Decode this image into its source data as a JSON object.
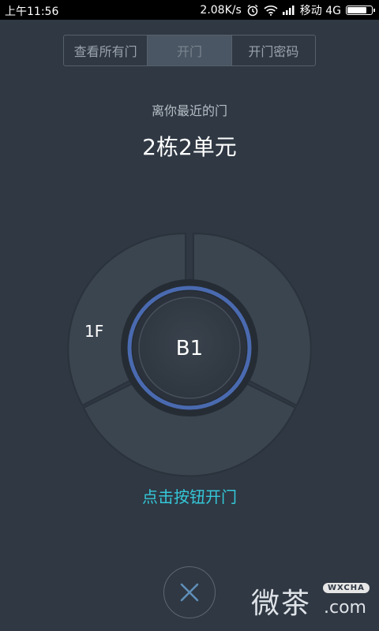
{
  "status_bar": {
    "time": "上午11:56",
    "speed": "2.08K/s",
    "carrier": "移动 4G",
    "battery_fraction": 0.85,
    "icons": [
      "alarm-icon",
      "wifi-icon",
      "signal-icon",
      "battery-icon"
    ]
  },
  "tabs": [
    {
      "label": "查看所有门",
      "active": false
    },
    {
      "label": "开门",
      "active": true
    },
    {
      "label": "开门密码",
      "active": false
    }
  ],
  "nearest": {
    "label": "离你最近的门",
    "door": "2栋2单元"
  },
  "dial": {
    "floors": [
      "1F"
    ],
    "center": "B1"
  },
  "hint": "点击按钮开门",
  "close_icon": "close-icon",
  "watermark": {
    "main": "微茶",
    "tag": "WXCHA",
    "domain": ".com"
  },
  "colors": {
    "background": "#2f3843",
    "hint": "#35c8d8",
    "ring_accent": "#4a6ab0"
  }
}
